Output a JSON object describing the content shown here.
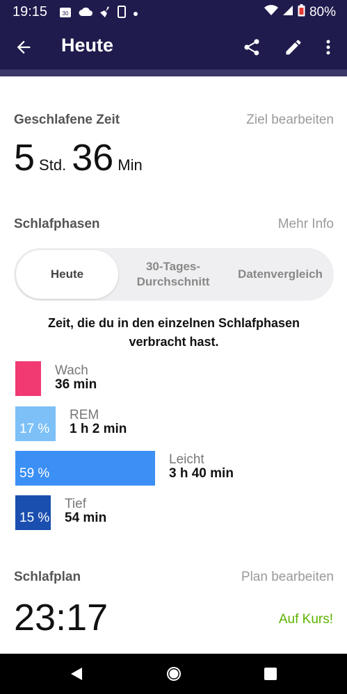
{
  "status_bar": {
    "time": "19:15",
    "calendar_day": "30",
    "battery": "80%"
  },
  "app_bar": {
    "title": "Heute"
  },
  "sleep_time": {
    "title": "Geschlafene Zeit",
    "edit_link": "Ziel bearbeiten",
    "hours": "5",
    "hours_unit": "Std.",
    "minutes": "36",
    "minutes_unit": "Min"
  },
  "sleep_phases": {
    "title": "Schlafphasen",
    "info_link": "Mehr Info",
    "tabs": [
      {
        "label": "Heute",
        "active": true
      },
      {
        "label": "30-Tages-Durchschnitt",
        "line1": "30-Tages-",
        "line2": "Durchschnitt",
        "active": false
      },
      {
        "label": "Datenvergleich",
        "active": false
      }
    ],
    "caption_line1": "Zeit, die du in den einzelnen Schlafphasen",
    "caption_line2": "verbracht hast.",
    "phases": [
      {
        "name": "Wach",
        "duration": "36 min",
        "percent_label": "",
        "share": 0.11,
        "color": "#f13a71"
      },
      {
        "name": "REM",
        "duration": "1 h 2 min",
        "percent_label": "17 %",
        "share": 0.17,
        "color": "#7cc0f7"
      },
      {
        "name": "Leicht",
        "duration": "3 h 40 min",
        "percent_label": "59 %",
        "share": 0.59,
        "color": "#3b8ff5"
      },
      {
        "name": "Tief",
        "duration": "54 min",
        "percent_label": "15 %",
        "share": 0.15,
        "color": "#1a4fb0"
      }
    ]
  },
  "sleep_plan": {
    "title": "Schlafplan",
    "edit_link": "Plan bearbeiten",
    "time": "23:17",
    "status": "Auf Kurs!",
    "status_color": "#5bb200"
  },
  "colors": {
    "header_bg": "#1f1b4d"
  }
}
